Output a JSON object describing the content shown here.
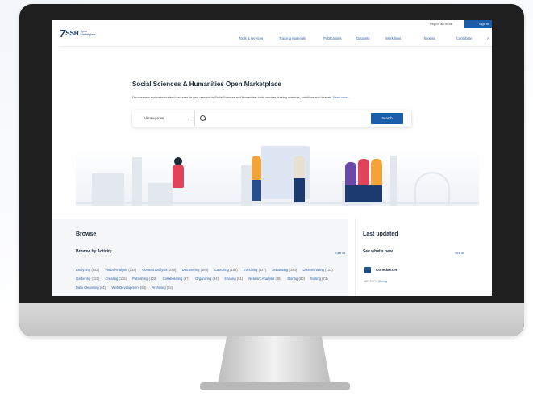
{
  "header": {
    "report_issue": "Report an issue",
    "sign_in": "Sign in",
    "logo_mark": "7",
    "logo_name": "SSH",
    "logo_sub": "Open Marketplace"
  },
  "nav": [
    "Tools & services",
    "Training materials",
    "Publications",
    "Datasets",
    "Workflows",
    "Browse",
    "Contribute",
    "A"
  ],
  "hero": {
    "title": "Social Sciences & Humanities Open Marketplace",
    "description": "Discover new and contextualised resources for your research in Social Sciences and Humanities: tools, services, training materials, workflows and datasets.",
    "read_more": "Read more...",
    "category_selected": "All categories",
    "search_placeholder": "",
    "search_button": "Search"
  },
  "browse": {
    "title": "Browse",
    "subtitle": "Browse by Activity",
    "see_all": "See all",
    "activities": [
      {
        "label": "Analyzing",
        "count": "(642)"
      },
      {
        "label": "Visual Analysis",
        "count": "(314)"
      },
      {
        "label": "Content Analysis",
        "count": "(230)"
      },
      {
        "label": "Discovering",
        "count": "(185)"
      },
      {
        "label": "Capturing",
        "count": "(153)"
      },
      {
        "label": "Enriching",
        "count": "(147)"
      },
      {
        "label": "Annotating",
        "count": "(143)"
      },
      {
        "label": "Disseminating",
        "count": "(133)"
      },
      {
        "label": "Gathering",
        "count": "(122)"
      },
      {
        "label": "Creating",
        "count": "(118)"
      },
      {
        "label": "Publishing",
        "count": "(103)"
      },
      {
        "label": "Collaborating",
        "count": "(97)"
      },
      {
        "label": "Organizing",
        "count": "(94)"
      },
      {
        "label": "Sharing",
        "count": "(91)"
      },
      {
        "label": "Network Analysis",
        "count": "(89)"
      },
      {
        "label": "Storing",
        "count": "(80)"
      },
      {
        "label": "Editing",
        "count": "(73)"
      },
      {
        "label": "Data Cleansing",
        "count": "(61)"
      },
      {
        "label": "Web Development",
        "count": "(54)"
      },
      {
        "label": "Archiving",
        "count": "(52)"
      }
    ]
  },
  "last_updated": {
    "title": "Last updated",
    "subtitle": "See what's new",
    "see_all": "See all",
    "item_name": "ConedaKOR",
    "item_meta_prefix": "ACTIVITY:",
    "item_meta_value": "Storing"
  },
  "colors": {
    "accent": "#1a5da8",
    "link": "#2a5ea6",
    "title": "#1c2a3a",
    "bezel": "#1f1f1f"
  }
}
